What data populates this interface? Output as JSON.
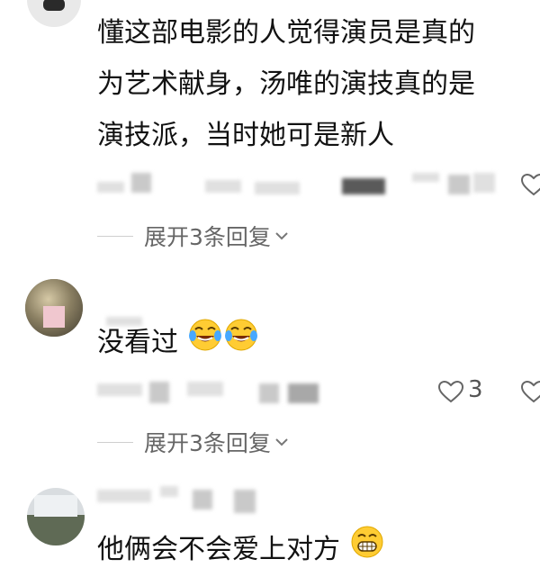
{
  "comments": [
    {
      "lines": [
        "懂这部电影的人觉得演员是真的",
        "为艺术献身，汤唯的演技真的是",
        "演技派，当时她可是新人"
      ],
      "expand_label": "展开3条回复"
    },
    {
      "text": "没看过",
      "emoji": [
        "laughing-crying-emoji",
        "laughing-crying-emoji"
      ],
      "like_count": "3",
      "expand_label": "展开3条回复"
    },
    {
      "text": "他俩会不会爱上对方",
      "emoji": [
        "grinning-emoji"
      ]
    }
  ],
  "colors": {
    "text": "#121212",
    "meta": "#666666",
    "emoji_face": "#FFCC33"
  }
}
